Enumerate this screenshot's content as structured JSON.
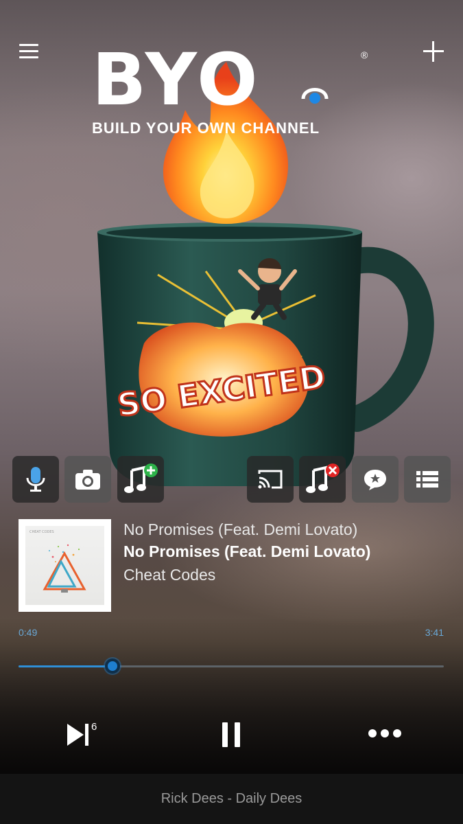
{
  "app": {
    "logo_text": "BYO",
    "logo_tagline": "BUILD YOUR OWN CHANNEL",
    "logo_reg": "®"
  },
  "artwork": {
    "sticker_text": "SO EXCITED"
  },
  "actions": {
    "left": [
      "microphone",
      "camera",
      "add-song"
    ],
    "right": [
      "cast",
      "remove-song",
      "favorite-comment",
      "queue-list"
    ]
  },
  "now_playing": {
    "subtitle": "No Promises (Feat. Demi Lovato)",
    "title": "No Promises (Feat. Demi Lovato)",
    "artist": "Cheat Codes",
    "album_cover_text": "CHEAT CODES"
  },
  "progress": {
    "current": "0:49",
    "total": "3:41",
    "fraction": 0.2217
  },
  "transport": {
    "skip_count": "6"
  },
  "footer": {
    "station": "Rick Dees - Daily Dees"
  },
  "colors": {
    "accent": "#2e8fd6",
    "add_green": "#2db34a",
    "remove_red": "#e02424"
  }
}
